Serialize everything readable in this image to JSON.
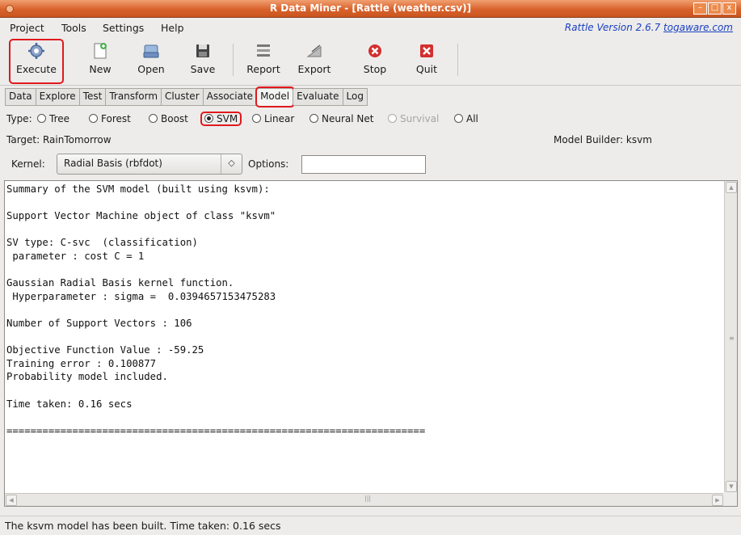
{
  "window": {
    "title": "R Data Miner - [Rattle (weather.csv)]",
    "min_label": "–",
    "max_label": "□",
    "close_label": "x"
  },
  "menu": {
    "items": [
      "Project",
      "Tools",
      "Settings",
      "Help"
    ],
    "version_text": "Rattle Version 2.6.7",
    "version_link": "togaware.com"
  },
  "toolbar": {
    "execute": "Execute",
    "new": "New",
    "open": "Open",
    "save": "Save",
    "report": "Report",
    "export": "Export",
    "stop": "Stop",
    "quit": "Quit"
  },
  "tabs": [
    "Data",
    "Explore",
    "Test",
    "Transform",
    "Cluster",
    "Associate",
    "Model",
    "Evaluate",
    "Log"
  ],
  "active_tab": "Model",
  "model_type": {
    "label": "Type:",
    "options": [
      "Tree",
      "Forest",
      "Boost",
      "SVM",
      "Linear",
      "Neural Net",
      "Survival",
      "All"
    ],
    "selected": "SVM",
    "disabled": [
      "Survival"
    ]
  },
  "target_text": "Target: RainTomorrow",
  "model_builder_text": "Model Builder:  ksvm",
  "kernel": {
    "label": "Kernel:",
    "value": "Radial Basis (rbfdot)",
    "arrow": "◇"
  },
  "options_label": "Options:",
  "options_value": "",
  "output_text": "Summary of the SVM model (built using ksvm):\n\nSupport Vector Machine object of class \"ksvm\"\n\nSV type: C-svc  (classification)\n parameter : cost C = 1\n\nGaussian Radial Basis kernel function.\n Hyperparameter : sigma =  0.0394657153475283\n\nNumber of Support Vectors : 106\n\nObjective Function Value : -59.25\nTraining error : 0.100877\nProbability model included.\n\nTime taken: 0.16 secs\n\n======================================================================",
  "status": "The ksvm model has been built. Time taken: 0.16 secs",
  "colors": {
    "highlight": "#e0191d",
    "titlebar": "#d9622c",
    "link": "#1a3fc0"
  }
}
